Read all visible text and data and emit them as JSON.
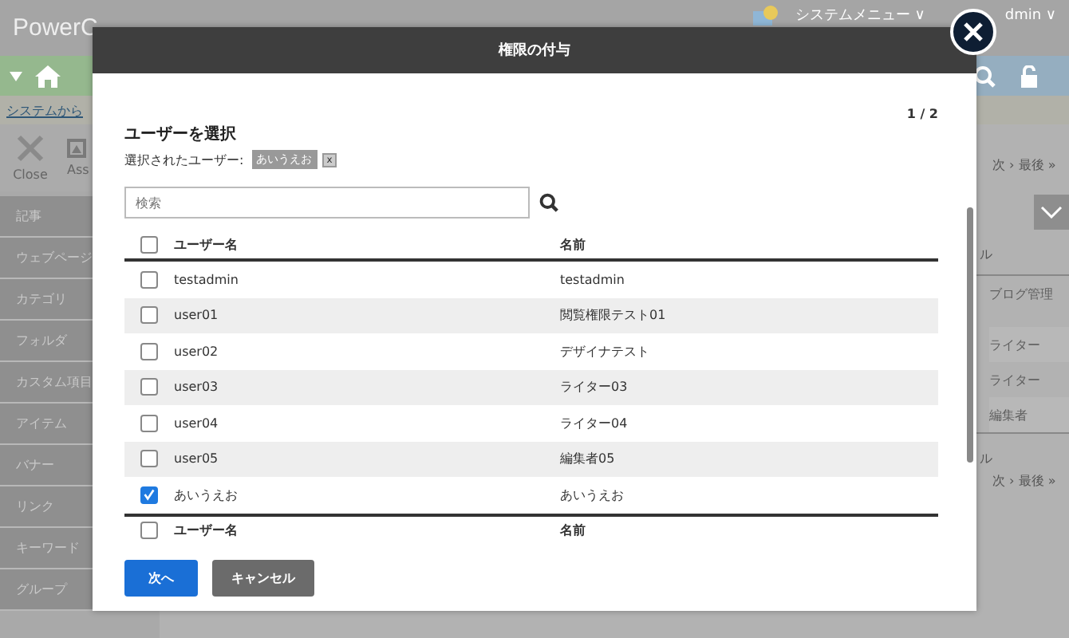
{
  "app": {
    "logo": "PowerC",
    "system_menu": "システムメニュー",
    "system_menu_caret": "∨",
    "user": "dmin",
    "user_caret": "∨",
    "notice_link": "システムから",
    "toolbar": [
      {
        "label": "Close",
        "kind": "close"
      },
      {
        "label": "Ass",
        "kind": "picture"
      }
    ],
    "sidebar": [
      "記事",
      "ウェブページ",
      "カテゴリ",
      "フォルダ",
      "カスタム項目",
      "アイテム",
      "バナー",
      "リンク",
      "キーワード",
      "グループ"
    ],
    "pager_top": "次 ›  最後 »",
    "label_top": "ル",
    "roles": [
      "ブログ管理",
      "ライター",
      "ライター",
      "編集者"
    ],
    "label_bottom": "ル",
    "pager_bottom": "次 ›  最後 »"
  },
  "dialog": {
    "title": "権限の付与",
    "heading": "ユーザーを選択",
    "page": "1 / 2",
    "selected_label": "選択されたユーザー:",
    "selected_tags": [
      {
        "label": "あいうえお",
        "remove": "x"
      }
    ],
    "search": {
      "placeholder": "検索"
    },
    "table_header": {
      "checked": false,
      "columns": [
        "ユーザー名",
        "名前"
      ]
    },
    "rows": [
      {
        "username": "testadmin",
        "name": "testadmin",
        "checked": false
      },
      {
        "username": "user01",
        "name": "閲覧権限テスト01",
        "checked": false
      },
      {
        "username": "user02",
        "name": "デザイナテスト",
        "checked": false
      },
      {
        "username": "user03",
        "name": "ライター03",
        "checked": false
      },
      {
        "username": "user04",
        "name": "ライター04",
        "checked": false
      },
      {
        "username": "user05",
        "name": "編集者05",
        "checked": false
      },
      {
        "username": "あいうえお",
        "name": "あいうえお",
        "checked": true
      }
    ],
    "table_footer": {
      "checked": false,
      "columns": [
        "ユーザー名",
        "名前"
      ]
    },
    "buttons": [
      {
        "label": "次へ",
        "kind": "primary"
      },
      {
        "label": "キャンセル",
        "kind": "secondary"
      }
    ]
  }
}
